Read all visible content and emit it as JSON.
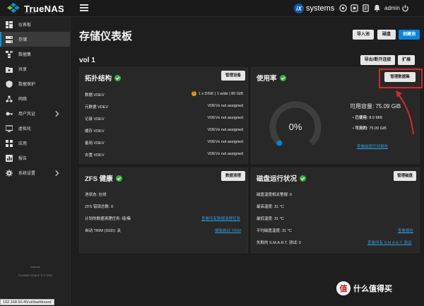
{
  "brand": {
    "name": "TrueNAS",
    "sub": "SCALE"
  },
  "topbar": {
    "vendor_mark": "iX",
    "vendor_name": "systems",
    "user": "admin"
  },
  "sidebar": {
    "items": [
      {
        "label": "仪表板",
        "icon": "dashboard-icon"
      },
      {
        "label": "存储",
        "icon": "storage-icon"
      },
      {
        "label": "数据集",
        "icon": "datasets-icon"
      },
      {
        "label": "共享",
        "icon": "shares-icon"
      },
      {
        "label": "数据保护",
        "icon": "data-protection-icon"
      },
      {
        "label": "网络",
        "icon": "network-icon"
      },
      {
        "label": "用户凭证",
        "icon": "credentials-icon"
      },
      {
        "label": "虚拟化",
        "icon": "virtualization-icon"
      },
      {
        "label": "应用",
        "icon": "apps-icon"
      },
      {
        "label": "报告",
        "icon": "reports-icon"
      },
      {
        "label": "系统设置",
        "icon": "system-settings-icon"
      }
    ],
    "active_index": 1,
    "footer_host": "truenas",
    "footer_copy": "TrueNAS SCALE ® © 2024"
  },
  "status_url": "192.168.50.45/ui/dashboard",
  "page": {
    "title": "存储仪表板",
    "import_pool": "导入池",
    "disks": "磁盘",
    "create_pool": "创建池",
    "pool_name": "vol 1",
    "export_disconnect": "导出/断开连接",
    "expand": "扩展"
  },
  "topology": {
    "title": "拓扑结构",
    "manage_btn": "管理设备",
    "rows": [
      {
        "label": "数据 VDEV",
        "value": "1 x DISK | 1 wide | 80 GiB",
        "warn": true
      },
      {
        "label": "元数据 VDEV",
        "value": "VDEVs not assigned"
      },
      {
        "label": "记录 VDEV",
        "value": "VDEVs not assigned"
      },
      {
        "label": "缓存 VDEV",
        "value": "VDEVs not assigned"
      },
      {
        "label": "备用 VDEV",
        "value": "VDEVs not assigned"
      },
      {
        "label": "去重 VDEV",
        "value": "VDEVs not assigned"
      }
    ],
    "warn_mark": "!"
  },
  "usage": {
    "title": "使用率",
    "manage_btn": "管理数据集",
    "percent": "0%",
    "usage_fraction": 0.0,
    "capacity_label": "可用容量:",
    "capacity_value": "75.09 GiB",
    "used_label": "已使用:",
    "used_value": "8.9 MiB",
    "avail_label": "可用的:",
    "avail_value": "75.09 GiB",
    "report_link": "查看磁盘空间报告"
  },
  "zfs": {
    "title": "ZFS 健康",
    "scrub_btn": "数据清理",
    "pool_state": "池状态: 在线",
    "errors": "ZFS 错误总数: 0",
    "scheduled_label": "计划的数据清理任务: 组/集",
    "scheduled_link": "查看所有数据清理任务",
    "trim_label": "自动 TRIM (SSD): 关",
    "trim_link": "编辑自动 TRIM"
  },
  "disk_health": {
    "title": "磁盘运行状况",
    "manage_btn": "管理磁盘",
    "temp_alerts": "磁盘温度相关警报: 0",
    "max_temp": "最高温度: 31 °C",
    "min_temp": "最低温度: 31 °C",
    "avg_temp": "平均磁盘温度: 31 °C",
    "reports_link": "查看报告",
    "smart_failed": "失败的 S.M.A.R.T. 测试: 0",
    "smart_link": "查看所有 S.M.A.R.T. 测试"
  },
  "watermark": {
    "logo_char": "值",
    "text": "什么值得买"
  },
  "colors": {
    "accent": "#0a84d8",
    "ok": "#3cb043",
    "warn": "#e8961b",
    "annotation": "#d8272d"
  }
}
